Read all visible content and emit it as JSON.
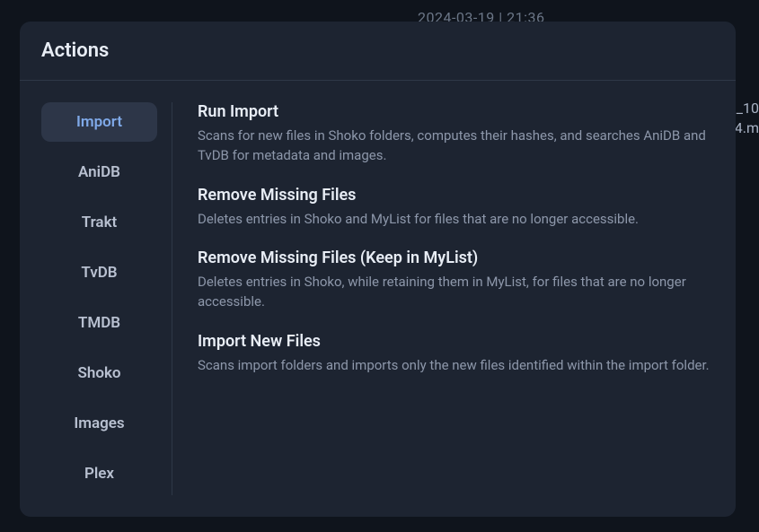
{
  "background": {
    "timestamp": "2024-03-19 | 21:36",
    "filename_line1": "_10",
    "filename_line2": "4.m"
  },
  "modal": {
    "title": "Actions"
  },
  "sidebar": {
    "tabs": [
      {
        "label": "Import",
        "active": true
      },
      {
        "label": "AniDB",
        "active": false
      },
      {
        "label": "Trakt",
        "active": false
      },
      {
        "label": "TvDB",
        "active": false
      },
      {
        "label": "TMDB",
        "active": false
      },
      {
        "label": "Shoko",
        "active": false
      },
      {
        "label": "Images",
        "active": false
      },
      {
        "label": "Plex",
        "active": false
      }
    ]
  },
  "actions": [
    {
      "title": "Run Import",
      "description": "Scans for new files in Shoko folders, computes their hashes, and searches AniDB and TvDB for metadata and images."
    },
    {
      "title": "Remove Missing Files",
      "description": "Deletes entries in Shoko and MyList for files that are no longer accessible."
    },
    {
      "title": "Remove Missing Files (Keep in MyList)",
      "description": "Deletes entries in Shoko, while retaining them in MyList, for files that are no longer accessible."
    },
    {
      "title": "Import New Files",
      "description": "Scans import folders and imports only the new files identified within the import folder."
    }
  ]
}
